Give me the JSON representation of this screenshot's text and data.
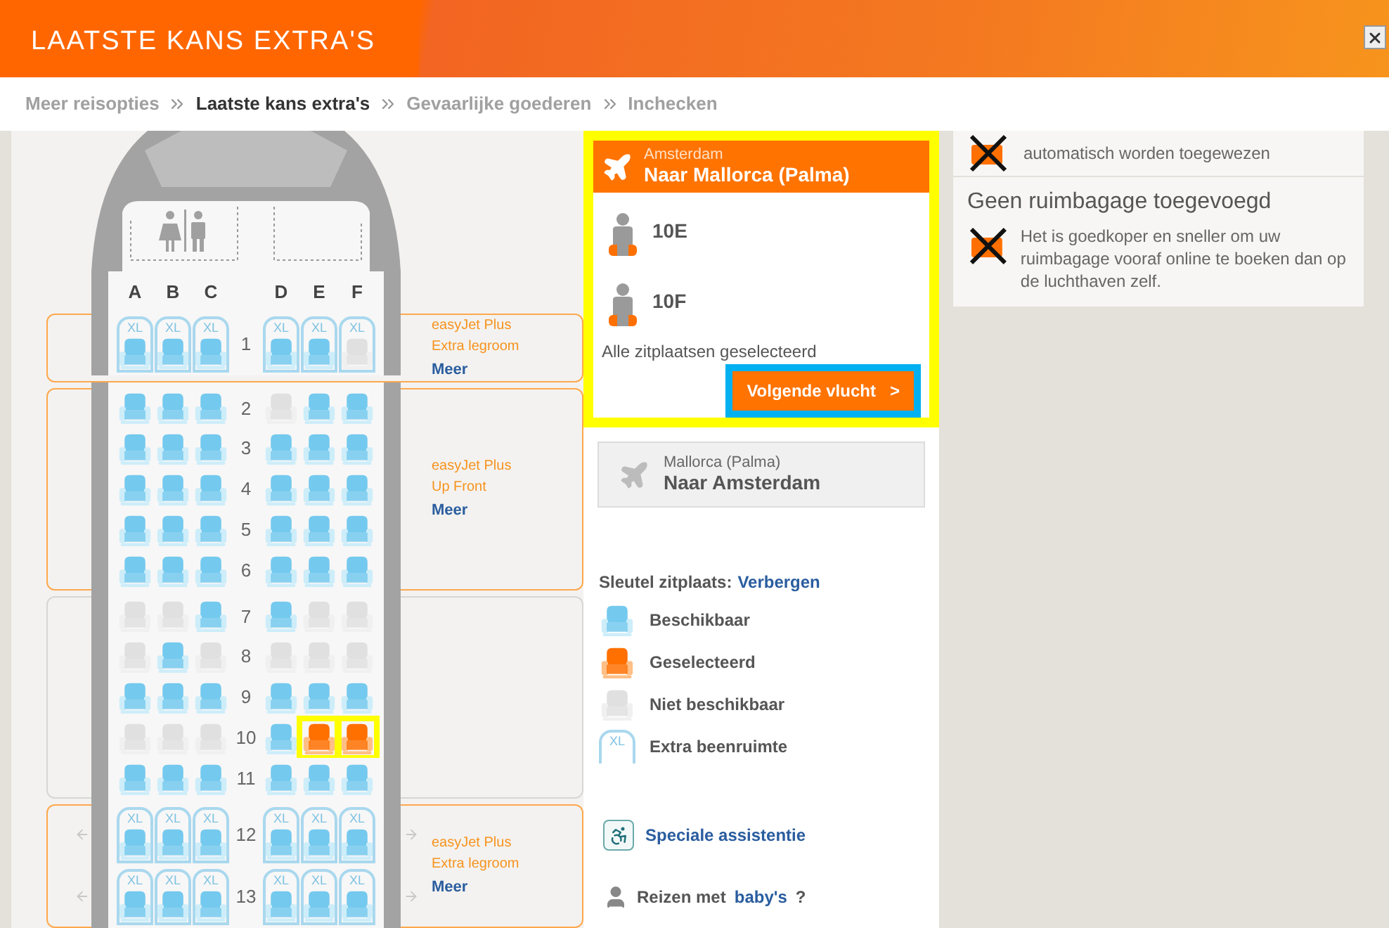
{
  "header": {
    "title": "LAATSTE KANS EXTRA'S"
  },
  "breadcrumb": [
    {
      "label": "Meer reisopties",
      "selected": false
    },
    {
      "label": "Laatste kans extra's",
      "selected": true
    },
    {
      "label": "Gevaarlijke goederen",
      "selected": false
    },
    {
      "label": "Inchecken",
      "selected": false
    }
  ],
  "seat_map": {
    "columns_left": [
      "A",
      "B",
      "C"
    ],
    "columns_right": [
      "D",
      "E",
      "F"
    ],
    "zones": [
      {
        "kind": "plus",
        "line1": "easyJet Plus",
        "line2": "Extra legroom",
        "link": "Meer",
        "rows": [
          {
            "number": "1",
            "exit": false,
            "seats": [
              {
                "label": "XL",
                "selected": false,
                "disabled": false
              },
              {
                "label": "XL",
                "selected": false,
                "disabled": false
              },
              {
                "label": "XL",
                "selected": false,
                "disabled": false
              },
              {
                "label": "XL",
                "selected": false,
                "disabled": false
              },
              {
                "label": "XL",
                "selected": false,
                "disabled": false
              },
              {
                "label": "XL",
                "selected": false,
                "disabled": true
              }
            ]
          }
        ]
      },
      {
        "kind": "plus",
        "line1": "easyJet Plus",
        "line2": "Up Front",
        "link": "Meer",
        "rows": [
          {
            "number": "2",
            "exit": false,
            "seats": [
              {
                "selected": false,
                "disabled": false
              },
              {
                "selected": false,
                "disabled": false
              },
              {
                "selected": false,
                "disabled": false
              },
              {
                "selected": false,
                "disabled": true
              },
              {
                "selected": false,
                "disabled": false
              },
              {
                "selected": false,
                "disabled": false
              }
            ]
          },
          {
            "number": "3",
            "exit": false,
            "seats": [
              {
                "selected": false,
                "disabled": false
              },
              {
                "selected": false,
                "disabled": false
              },
              {
                "selected": false,
                "disabled": false
              },
              {
                "selected": false,
                "disabled": false
              },
              {
                "selected": false,
                "disabled": false
              },
              {
                "selected": false,
                "disabled": false
              }
            ]
          },
          {
            "number": "4",
            "exit": false,
            "seats": [
              {
                "selected": false,
                "disabled": false
              },
              {
                "selected": false,
                "disabled": false
              },
              {
                "selected": false,
                "disabled": false
              },
              {
                "selected": false,
                "disabled": false
              },
              {
                "selected": false,
                "disabled": false
              },
              {
                "selected": false,
                "disabled": false
              }
            ]
          },
          {
            "number": "5",
            "exit": false,
            "seats": [
              {
                "selected": false,
                "disabled": false
              },
              {
                "selected": false,
                "disabled": false
              },
              {
                "selected": false,
                "disabled": false
              },
              {
                "selected": false,
                "disabled": false
              },
              {
                "selected": false,
                "disabled": false
              },
              {
                "selected": false,
                "disabled": false
              }
            ]
          },
          {
            "number": "6",
            "exit": false,
            "seats": [
              {
                "selected": false,
                "disabled": false
              },
              {
                "selected": false,
                "disabled": false
              },
              {
                "selected": false,
                "disabled": false
              },
              {
                "selected": false,
                "disabled": false
              },
              {
                "selected": false,
                "disabled": false
              },
              {
                "selected": false,
                "disabled": false
              }
            ]
          }
        ]
      },
      {
        "kind": "standard",
        "rows": [
          {
            "number": "7",
            "exit": false,
            "seats": [
              {
                "selected": false,
                "disabled": true
              },
              {
                "selected": false,
                "disabled": true
              },
              {
                "selected": false,
                "disabled": false
              },
              {
                "selected": false,
                "disabled": false
              },
              {
                "selected": false,
                "disabled": true
              },
              {
                "selected": false,
                "disabled": true
              }
            ]
          },
          {
            "number": "8",
            "exit": false,
            "seats": [
              {
                "selected": false,
                "disabled": true
              },
              {
                "selected": false,
                "disabled": false
              },
              {
                "selected": false,
                "disabled": true
              },
              {
                "selected": false,
                "disabled": true
              },
              {
                "selected": false,
                "disabled": true
              },
              {
                "selected": false,
                "disabled": true
              }
            ]
          },
          {
            "number": "9",
            "exit": false,
            "seats": [
              {
                "selected": false,
                "disabled": false
              },
              {
                "selected": false,
                "disabled": false
              },
              {
                "selected": false,
                "disabled": false
              },
              {
                "selected": false,
                "disabled": false
              },
              {
                "selected": false,
                "disabled": false
              },
              {
                "selected": false,
                "disabled": false
              }
            ]
          },
          {
            "number": "10",
            "exit": false,
            "seats": [
              {
                "selected": false,
                "disabled": true
              },
              {
                "selected": false,
                "disabled": true
              },
              {
                "selected": false,
                "disabled": true
              },
              {
                "selected": false,
                "disabled": false
              },
              {
                "selected": true,
                "disabled": false
              },
              {
                "selected": true,
                "disabled": false
              }
            ]
          },
          {
            "number": "11",
            "exit": false,
            "seats": [
              {
                "selected": false,
                "disabled": false
              },
              {
                "selected": false,
                "disabled": false
              },
              {
                "selected": false,
                "disabled": false
              },
              {
                "selected": false,
                "disabled": false
              },
              {
                "selected": false,
                "disabled": false
              },
              {
                "selected": false,
                "disabled": false
              }
            ]
          }
        ]
      },
      {
        "kind": "plus",
        "line1": "easyJet Plus",
        "line2": "Extra legroom",
        "link": "Meer",
        "rows": [
          {
            "number": "12",
            "exit": true,
            "seats": [
              {
                "label": "XL",
                "selected": false,
                "disabled": false
              },
              {
                "label": "XL",
                "selected": false,
                "disabled": false
              },
              {
                "label": "XL",
                "selected": false,
                "disabled": false
              },
              {
                "label": "XL",
                "selected": false,
                "disabled": false
              },
              {
                "label": "XL",
                "selected": false,
                "disabled": false
              },
              {
                "label": "XL",
                "selected": false,
                "disabled": false
              }
            ]
          },
          {
            "number": "13",
            "exit": true,
            "seats": [
              {
                "label": "XL",
                "selected": false,
                "disabled": false
              },
              {
                "label": "XL",
                "selected": false,
                "disabled": false
              },
              {
                "label": "XL",
                "selected": false,
                "disabled": false
              },
              {
                "label": "XL",
                "selected": false,
                "disabled": false
              },
              {
                "label": "XL",
                "selected": false,
                "disabled": false
              },
              {
                "label": "XL",
                "selected": false,
                "disabled": false
              }
            ]
          }
        ]
      }
    ]
  },
  "flights": [
    {
      "from": "Amsterdam",
      "to": "Naar Mallorca (Palma)",
      "selected": true,
      "highlighted": true,
      "passengers": [
        "10E",
        "10F"
      ],
      "status": "Alle zitplaatsen geselecteerd",
      "button": {
        "label": "Volgende vlucht",
        "icon": ">",
        "highlighted": true
      }
    },
    {
      "from": "Mallorca (Palma)",
      "to": "Naar Amsterdam",
      "selected": false
    }
  ],
  "legend": {
    "title": "Sleutel zitplaats:",
    "toggle": "Verbergen",
    "items": [
      {
        "kind": "available",
        "label": "Beschikbaar"
      },
      {
        "kind": "selected",
        "label": "Geselecteerd"
      },
      {
        "kind": "unavailable",
        "label": "Niet beschikbaar"
      },
      {
        "kind": "xl",
        "icon_label": "XL",
        "label": "Extra beenruimte"
      }
    ]
  },
  "assistance": {
    "label": "Speciale assistentie"
  },
  "babies": {
    "prefix": "Reizen met",
    "link": "baby's",
    "suffix": "?"
  },
  "baggage": {
    "previous_text": "automatisch worden toegewezen",
    "title": "Geen ruimbagage toegevoegd",
    "text": "Het is goedkoper en sneller om uw ruimbagage vooraf online te boeken dan op de luchthaven zelf."
  }
}
